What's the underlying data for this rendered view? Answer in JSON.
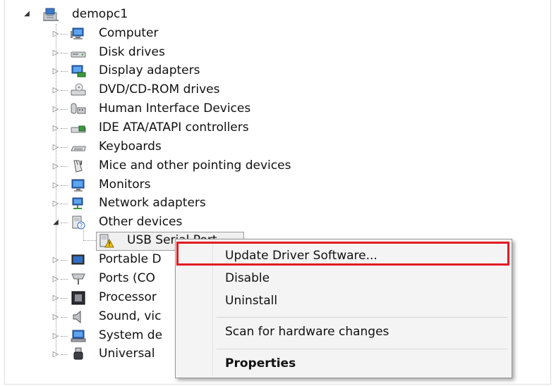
{
  "tree": {
    "root": {
      "label": "demopc1",
      "icon": "computer-network-icon"
    },
    "categories": [
      {
        "label": "Computer",
        "icon": "computer-icon"
      },
      {
        "label": "Disk drives",
        "icon": "disk-drive-icon"
      },
      {
        "label": "Display adapters",
        "icon": "display-adapter-icon"
      },
      {
        "label": "DVD/CD-ROM drives",
        "icon": "dvd-drive-icon"
      },
      {
        "label": "Human Interface Devices",
        "icon": "hid-icon"
      },
      {
        "label": "IDE ATA/ATAPI controllers",
        "icon": "ide-controller-icon"
      },
      {
        "label": "Keyboards",
        "icon": "keyboard-icon"
      },
      {
        "label": "Mice and other pointing devices",
        "icon": "mouse-icon"
      },
      {
        "label": "Monitors",
        "icon": "monitor-icon"
      },
      {
        "label": "Network adapters",
        "icon": "network-adapter-icon"
      },
      {
        "label": "Other devices",
        "icon": "unknown-device-icon"
      },
      {
        "label": "Portable D",
        "icon": "portable-device-icon"
      },
      {
        "label": "Ports (CO",
        "icon": "port-icon"
      },
      {
        "label": "Processor",
        "icon": "processor-icon"
      },
      {
        "label": "Sound, vic",
        "icon": "speaker-icon"
      },
      {
        "label": "System de",
        "icon": "system-device-icon"
      },
      {
        "label": "Universal",
        "icon": "usb-icon"
      }
    ],
    "child": {
      "label": "USB Serial Port",
      "icon": "warning-device-icon"
    }
  },
  "context_menu": {
    "items": {
      "update": "Update Driver Software...",
      "disable": "Disable",
      "uninstall": "Uninstall",
      "scan": "Scan for hardware changes",
      "properties": "Properties"
    },
    "highlight_color": "#e21b23"
  }
}
